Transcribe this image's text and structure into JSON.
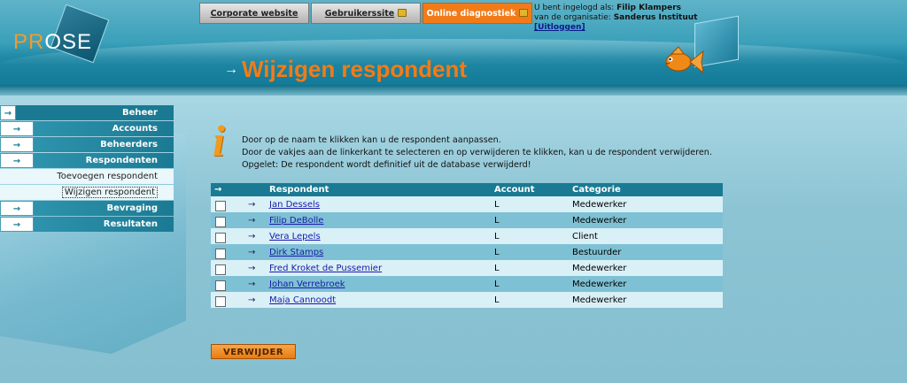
{
  "header": {
    "logo_text_a": "PR",
    "logo_text_b": "O",
    "logo_text_c": "SE",
    "tabs": [
      {
        "label": "Corporate website",
        "locked": false
      },
      {
        "label": "Gebruikerssite",
        "locked": true
      },
      {
        "label": "Online diagnostiek",
        "locked": true
      }
    ],
    "user_prefix": "U bent ingelogd als:",
    "user_name": "Filip Klampers",
    "org_prefix": "van de organisatie:",
    "org_name": "Sanderus Instituut",
    "logout_label": "[Uitloggen]"
  },
  "page_title": "Wijzigen respondent",
  "page_title_arrow": "→",
  "sidebar": {
    "header": "Beheer",
    "items": [
      {
        "label": "Accounts"
      },
      {
        "label": "Beheerders"
      },
      {
        "label": "Respondenten"
      }
    ],
    "subitems": [
      {
        "label": "Toevoegen respondent",
        "active": false
      },
      {
        "label": "Wijzigen respondent",
        "active": true
      }
    ],
    "items_after": [
      {
        "label": "Bevraging"
      },
      {
        "label": "Resultaten"
      }
    ],
    "arrow": "→"
  },
  "info": {
    "icon": "i",
    "line1": "Door op de naam te klikken kan u de respondent aanpassen.",
    "line2": "Door de vakjes aan de linkerkant te selecteren en op verwijderen te klikken, kan u de respondent verwijderen.",
    "line3": "Opgelet: De respondent wordt definitief uit de database verwijderd!"
  },
  "table": {
    "header_arrow": "→",
    "columns": [
      "Respondent",
      "Account",
      "Categorie"
    ],
    "rows": [
      {
        "name": "Jan Dessels",
        "account": "L",
        "category": "Medewerker"
      },
      {
        "name": "Filip DeBolle",
        "account": "L",
        "category": "Medewerker"
      },
      {
        "name": "Vera Lepels",
        "account": "L",
        "category": "Client"
      },
      {
        "name": "Dirk Stamps",
        "account": "L",
        "category": "Bestuurder"
      },
      {
        "name": "Fred Kroket de Pussemier",
        "account": "L",
        "category": "Medewerker"
      },
      {
        "name": "Johan Verrebroek",
        "account": "L",
        "category": "Medewerker"
      },
      {
        "name": "Maja Cannoodt",
        "account": "L",
        "category": "Medewerker"
      }
    ],
    "row_arrow": "→"
  },
  "delete_button": "VERWIJDER",
  "colors": {
    "accent_orange": "#f27b18",
    "sidebar_blue": "#1b7a93",
    "row_light": "#d9f0f7",
    "row_dark": "#7fc1d4"
  }
}
